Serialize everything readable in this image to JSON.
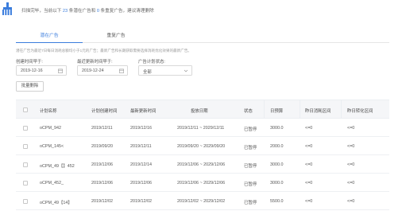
{
  "banner": {
    "prefix": "扫描完毕，当前以下",
    "count_a": "23",
    "middle": "条潜在广告和",
    "count_b": "0",
    "suffix": "条重复广告，建议清理删除"
  },
  "tabs": [
    {
      "label": "潜在广告",
      "active": true
    },
    {
      "label": "重复广告",
      "active": false
    }
  ],
  "hint": "潜在广告为最近7日每日消耗总额均小于1元的广告；最新广告和长期获取需要选择消耗优化效果的最新广告。",
  "filters": {
    "created_before": {
      "label": "创建时间早于:",
      "value": "2019-12-16",
      "icon": "calendar-icon"
    },
    "last_modified_before": {
      "label": "最近更新时间早于:",
      "value": "2019-12-24",
      "icon": "calendar-icon"
    },
    "plan_status": {
      "label": "广告计划状态:",
      "value": "全部",
      "icon": "chevron-down-icon"
    }
  },
  "export_button": "批量删除",
  "table": {
    "columns": [
      "计划名称",
      "计划创建时间",
      "最新更新时间",
      "投放日期",
      "状态",
      "日预算",
      "昨日消耗区间",
      "昨日转化区间"
    ],
    "rows": [
      {
        "name": "oCPM_942",
        "created": "2019/12/11",
        "updated": "2019/12/16",
        "dates": "2019/12/11 ~ 2029/12/11",
        "status": "已暂停",
        "budget": "3000.0",
        "spend": "<=0",
        "conv": "<=0"
      },
      {
        "name": "oCPM_145<",
        "created": "2019/09/20",
        "updated": "2019/12/11",
        "dates": "2019/09/20 ~ 2029/09/20",
        "status": "已暂停",
        "budget": "2000.0",
        "spend": "<=0",
        "conv": "<=0"
      },
      {
        "name": "oCPM_49【】452",
        "created": "2019/12/06",
        "updated": "2019/12/14",
        "dates": "2019/12/06 ~ 2029/12/06",
        "status": "已暂停",
        "budget": "3000.0",
        "spend": "<=0",
        "conv": "<=0"
      },
      {
        "name": "oCPM_452_",
        "created": "2019/12/06",
        "updated": "2019/12/06",
        "dates": "2019/12/06 ~ 2029/12/06",
        "status": "已暂停",
        "budget": "3000.0",
        "spend": "<=0",
        "conv": "<=0"
      },
      {
        "name": "oCPM_49【14】",
        "created": "2019/12/02",
        "updated": "2019/12/02",
        "dates": "2019/12/02 ~ 2029/12/02",
        "status": "已暂停",
        "budget": "5500.0",
        "spend": "<=0",
        "conv": "<=0"
      }
    ]
  },
  "colors": {
    "accent": "#3b7ddd",
    "logo": "#3b7ddd",
    "header_bg": "#f5f6f8"
  }
}
